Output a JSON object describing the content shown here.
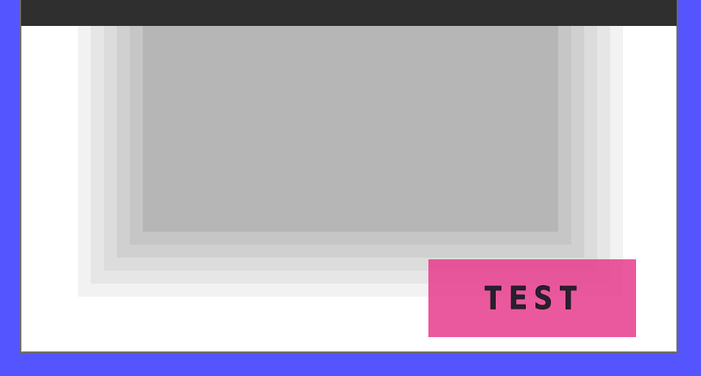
{
  "window": {
    "titlebar": {
      "title": ""
    }
  },
  "content": {
    "test_button_label": "TEST"
  },
  "colors": {
    "desktop_background": "#5555ff",
    "titlebar": "#2f2f2f",
    "panel": "#b6b6b6",
    "button_accent": "#e63c8c"
  }
}
